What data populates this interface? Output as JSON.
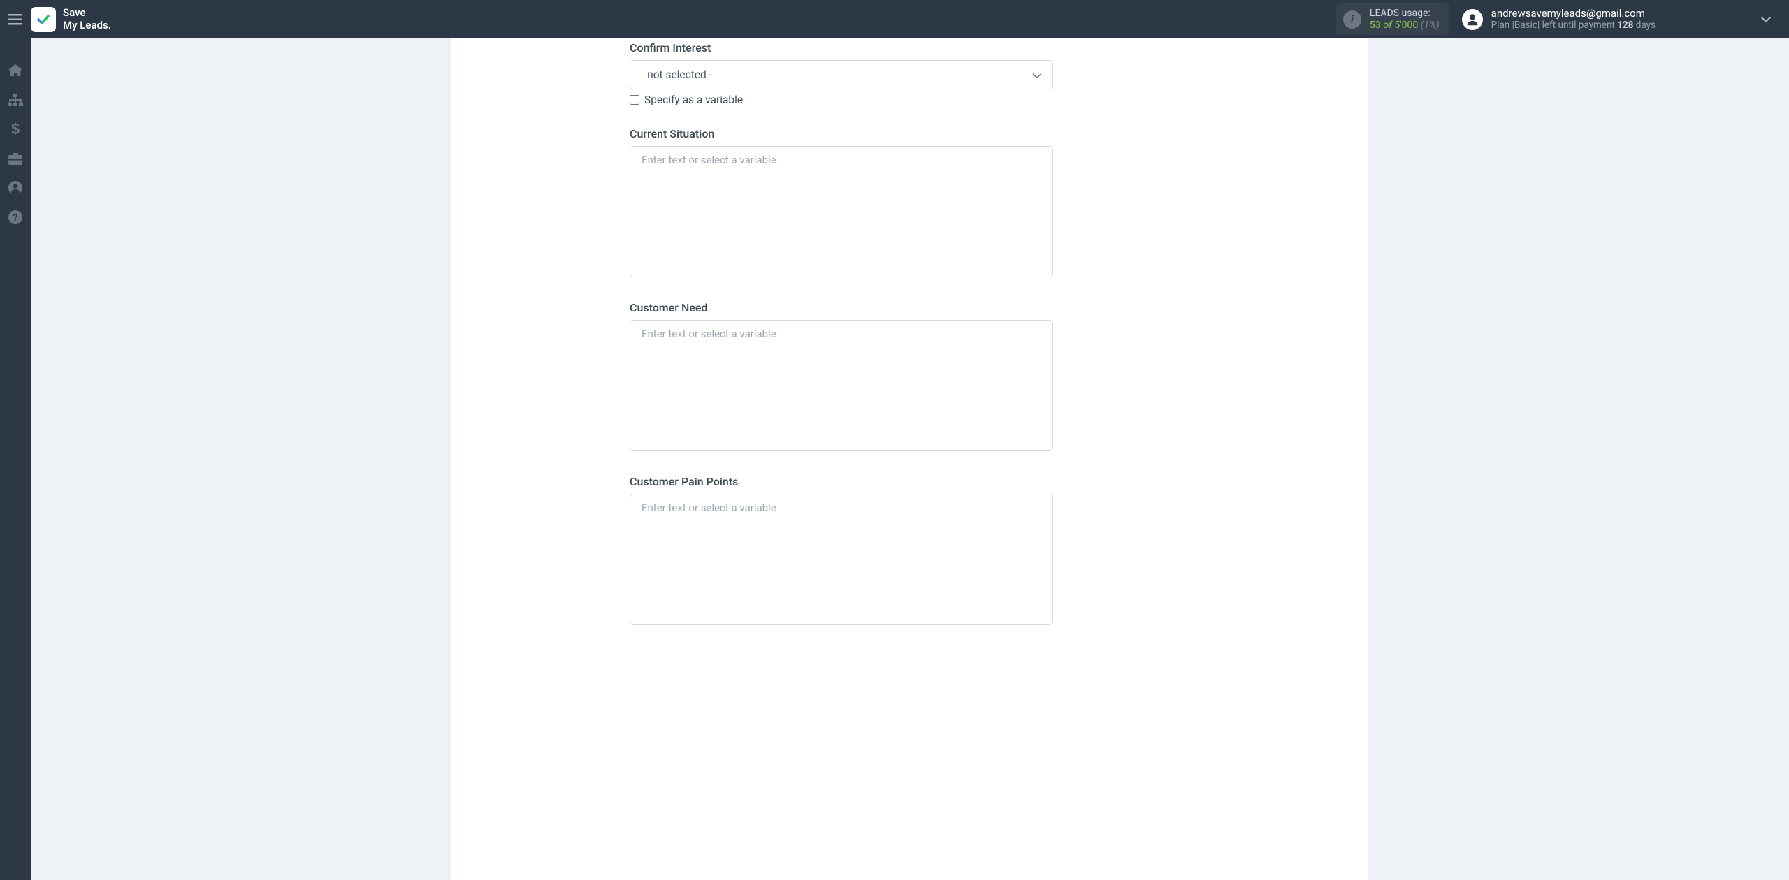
{
  "header": {
    "logo_line1": "Save",
    "logo_line2": "My Leads.",
    "usage": {
      "label": "LEADS usage:",
      "current": "53",
      "of": "of",
      "total": "5'000",
      "percent": "(1%)"
    },
    "user": {
      "email": "andrewsavemyleads@gmail.com",
      "plan_prefix": "Plan |",
      "plan_name": "Basic",
      "plan_mid": "| left until payment ",
      "plan_days": "128",
      "plan_suffix": " days"
    }
  },
  "form": {
    "confirm_interest": {
      "label": "Confirm Interest",
      "value": "- not selected -",
      "checkbox_label": "Specify as a variable"
    },
    "current_situation": {
      "label": "Current Situation",
      "placeholder": "Enter text or select a variable"
    },
    "customer_need": {
      "label": "Customer Need",
      "placeholder": "Enter text or select a variable"
    },
    "customer_pain_points": {
      "label": "Customer Pain Points",
      "placeholder": "Enter text or select a variable"
    }
  }
}
